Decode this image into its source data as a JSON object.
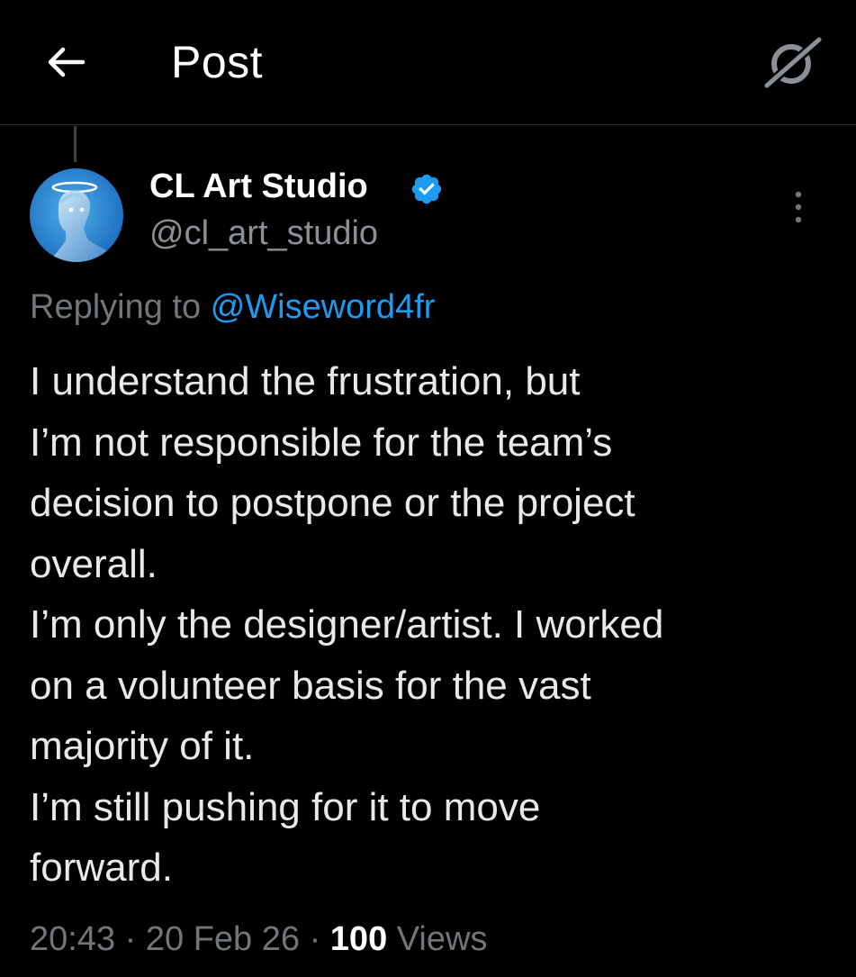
{
  "header": {
    "back_icon": "back-arrow-icon",
    "title": "Post",
    "grok_icon": "grok-icon"
  },
  "post": {
    "author": {
      "name": "CL Art Studio",
      "handle": "@cl_art_studio",
      "verified": true,
      "verified_color": "#1d9bf0"
    },
    "more_icon": "more-vertical-icon",
    "replying_label": "Replying to",
    "replying_to": "@Wiseword4fr",
    "body_lines": [
      "I understand the frustration, but",
      "I’m not responsible for the team’s",
      "decision to postpone or the project",
      "overall.",
      "I’m only the designer/artist. I worked",
      "on a volunteer basis for the vast",
      "majority of it.",
      "I’m still pushing for it to move",
      "forward."
    ],
    "time": "20:43",
    "separator": "·",
    "date": "20 Feb 26",
    "views_count": "100",
    "views_label": "Views"
  },
  "colors": {
    "background": "#000000",
    "text_primary": "#e7e9ea",
    "text_secondary": "#71767b",
    "link": "#1d9bf0",
    "divider": "#2f3336"
  }
}
